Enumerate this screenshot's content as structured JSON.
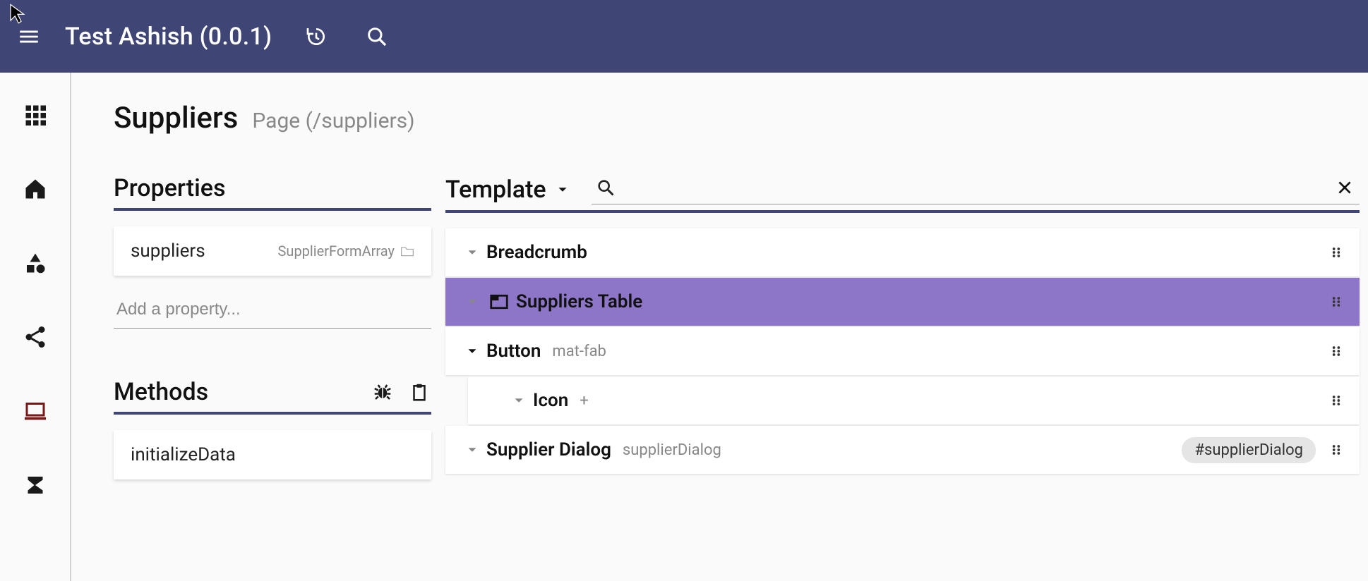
{
  "header": {
    "title": "Test Ashish (0.0.1)"
  },
  "page": {
    "title": "Suppliers",
    "subtitle": "Page (/suppliers)"
  },
  "properties": {
    "panel_label": "Properties",
    "items": [
      {
        "name": "suppliers",
        "type": "SupplierFormArray"
      }
    ],
    "add_placeholder": "Add a property..."
  },
  "methods": {
    "panel_label": "Methods",
    "items": [
      {
        "name": "initializeData"
      }
    ]
  },
  "template": {
    "panel_label": "Template",
    "search_value": "",
    "tree": [
      {
        "label": "Breadcrumb",
        "sub": "",
        "expanded": false,
        "selected": false,
        "indent": 0,
        "icon": "",
        "badge": ""
      },
      {
        "label": "Suppliers Table",
        "sub": "",
        "expanded": false,
        "selected": true,
        "indent": 0,
        "icon": "tab",
        "badge": ""
      },
      {
        "label": "Button",
        "sub": "mat-fab",
        "expanded": true,
        "selected": false,
        "indent": 0,
        "icon": "",
        "badge": ""
      },
      {
        "label": "Icon",
        "sub": "+",
        "expanded": false,
        "selected": false,
        "indent": 1,
        "icon": "",
        "badge": ""
      },
      {
        "label": "Supplier Dialog",
        "sub": "supplierDialog",
        "expanded": false,
        "selected": false,
        "indent": 0,
        "icon": "",
        "badge": "#supplierDialog"
      }
    ]
  }
}
